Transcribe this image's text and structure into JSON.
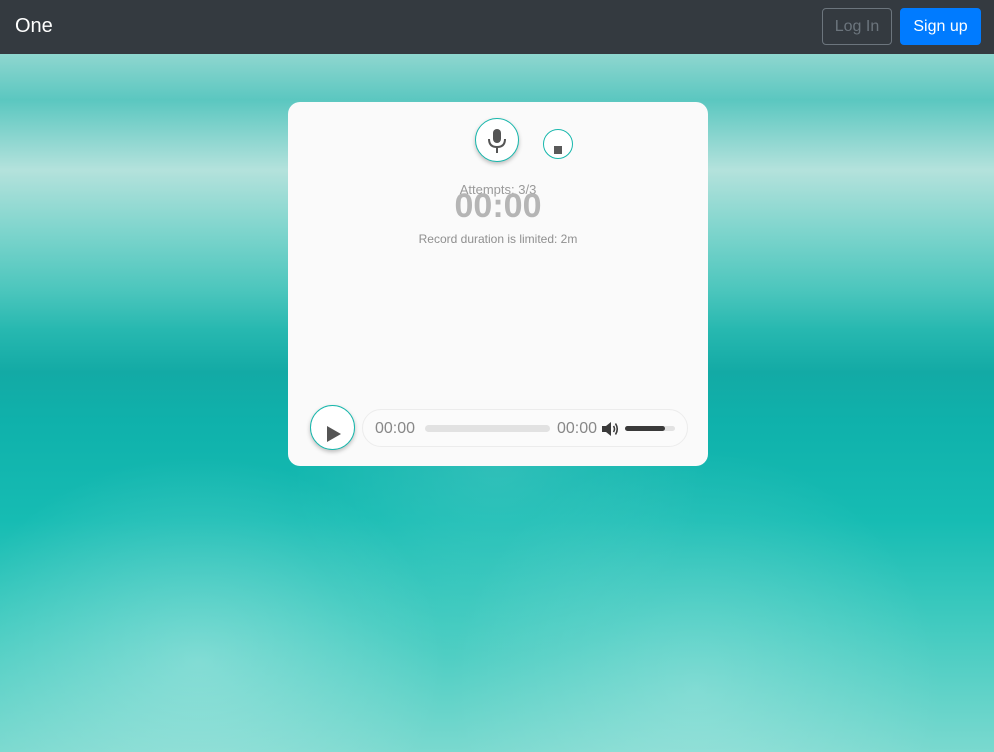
{
  "navbar": {
    "brand": "One",
    "login_label": "Log In",
    "signup_label": "Sign up"
  },
  "recorder": {
    "mic_icon": "microphone-icon",
    "stop_icon": "stop-icon",
    "attempts": "Attempts: 3/3",
    "timer": "00:00",
    "limit_text": "Record duration is limited: 2m"
  },
  "player": {
    "play_icon": "play-icon",
    "current_time": "00:00",
    "duration": "00:00",
    "progress": 0,
    "volume_icon": "volume-icon",
    "volume_level": 0.8
  },
  "colors": {
    "accent": "#17b7ac",
    "navbar_bg": "#343a40",
    "signup_bg": "#007bff"
  }
}
